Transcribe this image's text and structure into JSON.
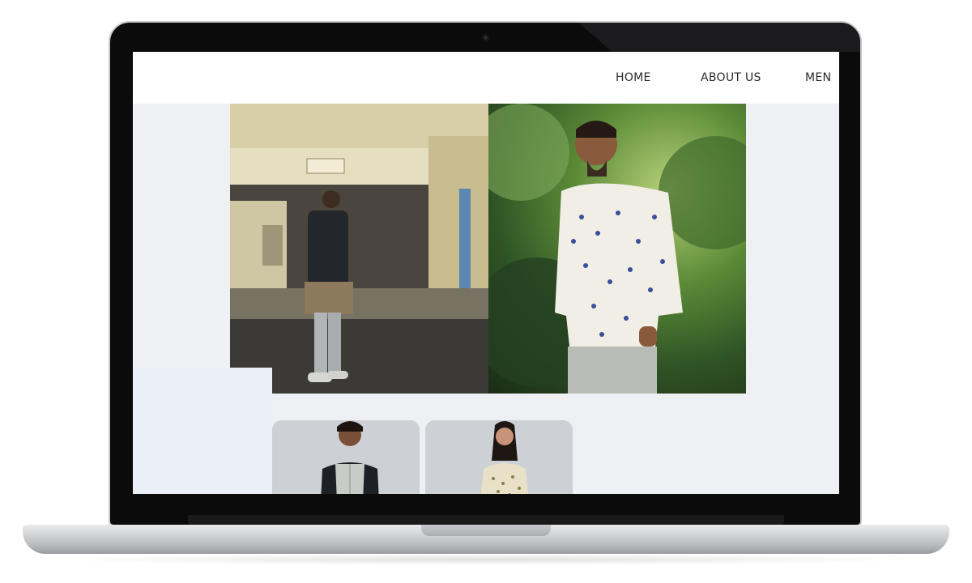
{
  "nav": {
    "items": [
      {
        "label": "HOME"
      },
      {
        "label": "ABOUT US"
      },
      {
        "label": "MEN"
      }
    ]
  },
  "colors": {
    "page_background": "#eef0f3",
    "header_background": "#ffffff",
    "nav_text": "#2b2b2b"
  }
}
